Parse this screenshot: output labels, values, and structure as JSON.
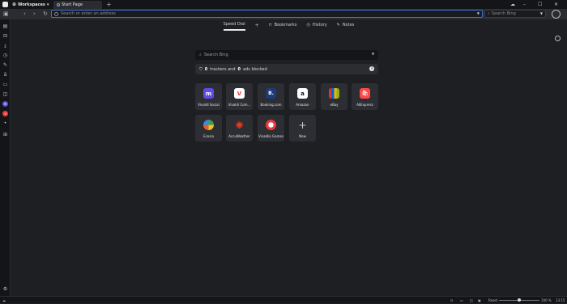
{
  "titlebar": {
    "workspaces_label": "Workspaces",
    "tab_title": "Start Page",
    "new_tab": "+",
    "minimize": "–",
    "maximize": "☐",
    "close": "✕"
  },
  "addressbar": {
    "placeholder": "Search or enter an address",
    "search_placeholder": "Search Bing"
  },
  "startpage": {
    "tabs": [
      {
        "label": "Speed Dial",
        "active": true
      },
      {
        "label": "Bookmarks"
      },
      {
        "label": "History"
      },
      {
        "label": "Notes"
      }
    ],
    "add": "+",
    "bing_placeholder": "Search Bing",
    "trackers_count": "0",
    "trackers_text_1": "trackers and",
    "ads_count": "0",
    "trackers_text_2": "ads blocked",
    "speed_dial": [
      {
        "label": "Vivaldi Social",
        "glyph": "m",
        "color": "#5b4ee0"
      },
      {
        "label": "Vivaldi Com...",
        "glyph": "V",
        "color": "#ef3939"
      },
      {
        "label": "Booking.com",
        "glyph": "B.",
        "color": "#1b3b7a"
      },
      {
        "label": "Amazon",
        "glyph": "a",
        "color": "#ffffff"
      },
      {
        "label": "eBay",
        "glyph": "",
        "color": "#e53238"
      },
      {
        "label": "AliExpress",
        "glyph": "🛍",
        "color": "#ff4747"
      },
      {
        "label": "Ecosia",
        "glyph": "",
        "color": "#3c9a5a"
      },
      {
        "label": "AccuWeather",
        "glyph": "✺",
        "color": "#ef3b1a"
      },
      {
        "label": "Vivaldia Games",
        "glyph": "",
        "color": "#ef3939"
      },
      {
        "label": "New",
        "glyph": "+",
        "color": "transparent"
      }
    ]
  },
  "statusbar": {
    "reset": "Reset",
    "zoom": "100 %",
    "time": "13:15",
    "zoom_level": 0.5
  },
  "colors": {
    "accent": "#3f74d8",
    "background": "#1e1f22",
    "panel": "#2c2e33"
  },
  "icons": {
    "sidebar": [
      "panel-toggle-icon",
      "bookmarks-icon",
      "downloads-icon",
      "history-icon",
      "notes-icon",
      "translate-icon",
      "window-icon",
      "mail-icon",
      "mastodon-icon",
      "vivaldi-icon",
      "add-panel-icon",
      "settings-icon"
    ]
  }
}
